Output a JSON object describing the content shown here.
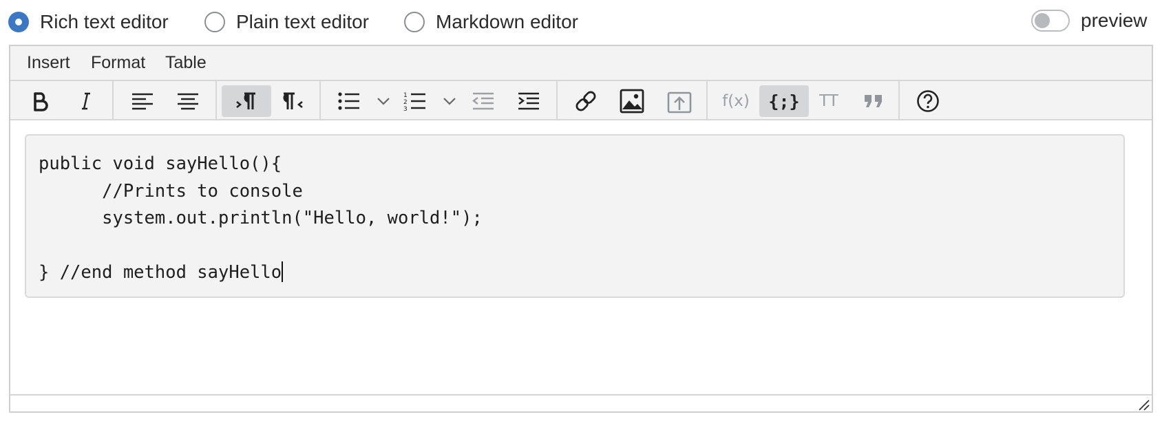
{
  "editor_modes": {
    "rich": "Rich text editor",
    "plain": "Plain text editor",
    "markdown": "Markdown editor",
    "selected": "Rich text editor"
  },
  "preview": {
    "label": "preview",
    "enabled": false
  },
  "menubar": [
    "Insert",
    "Format",
    "Table"
  ],
  "toolbar_text": {
    "fx": "f(x)",
    "tt": "TT"
  },
  "toolbar_icons": [
    "bold-icon",
    "italic-icon",
    "align-left-icon",
    "align-center-icon",
    "ltr-paragraph-icon",
    "rtl-paragraph-icon",
    "bullet-list-icon",
    "chevron-down-icon",
    "numbered-list-icon",
    "chevron-down-icon",
    "outdent-icon",
    "indent-icon",
    "link-icon",
    "image-icon",
    "upload-icon",
    "equation-icon",
    "code-block-icon",
    "monospace-icon",
    "blockquote-icon",
    "help-icon"
  ],
  "active_tools": [
    "ltr-paragraph",
    "code-block"
  ],
  "code_lines": [
    "public void sayHello(){",
    "      //Prints to console",
    "      system.out.println(\"Hello, world!\");",
    "",
    "} //end method sayHello"
  ],
  "colors": {
    "accent": "#3b78c3",
    "toolbar_bg": "#f3f3f3",
    "code_bg": "#f3f3f3",
    "active_tool_bg": "#d4d6d8"
  }
}
